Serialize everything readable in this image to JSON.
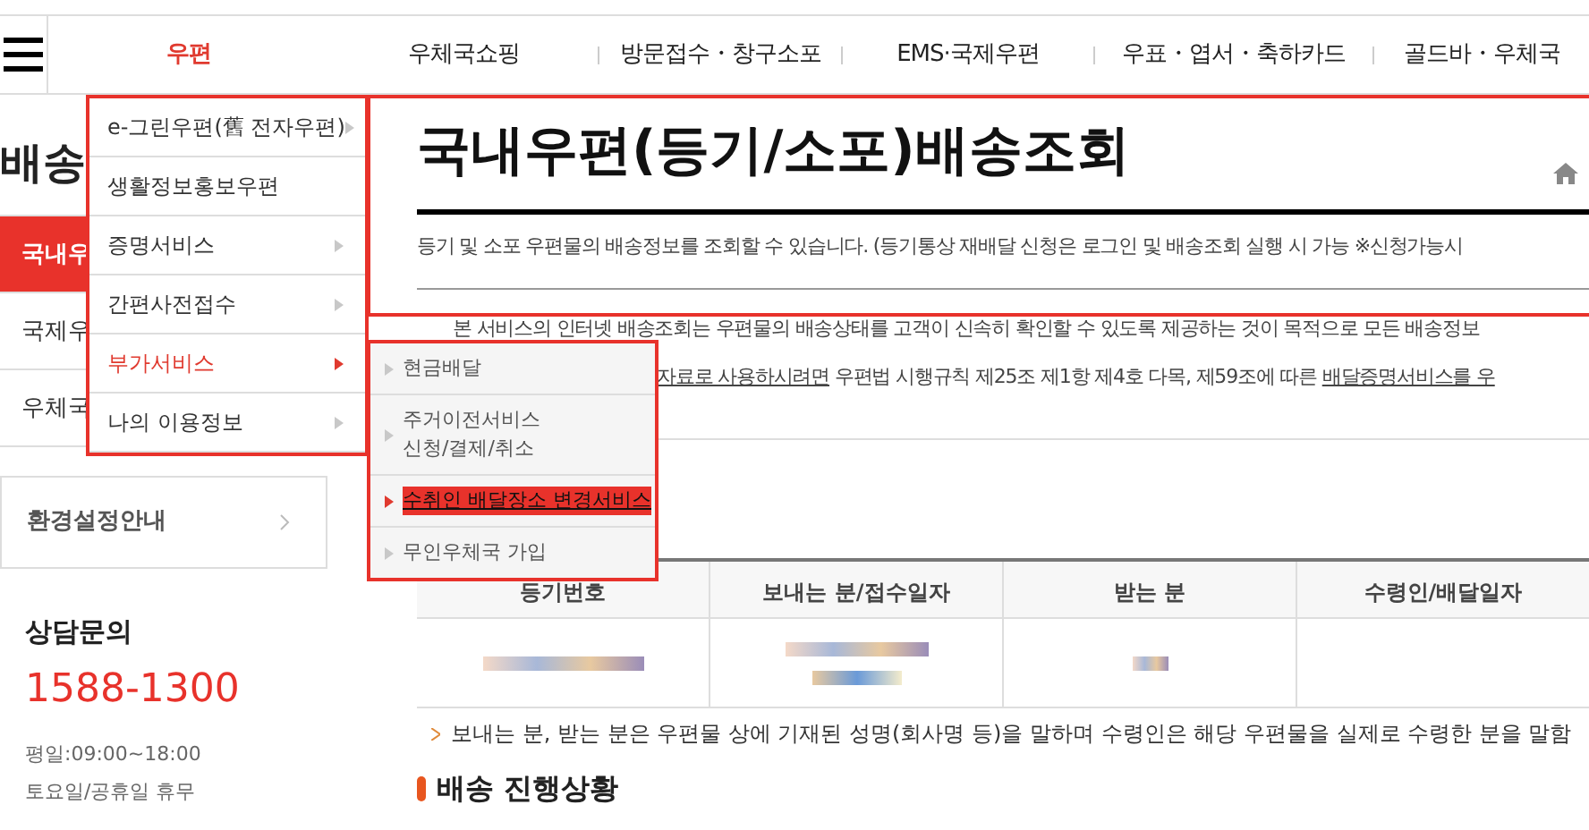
{
  "nav": {
    "items": [
      {
        "label": "우편",
        "selected": true
      },
      {
        "label": "우체국쇼핑",
        "selected": false
      },
      {
        "label": "방문접수・창구소포",
        "selected": false
      },
      {
        "label": "EMS·국제우편",
        "selected": false
      },
      {
        "label": "우표・엽서・축하카드",
        "selected": false
      },
      {
        "label": "골드바・우체국",
        "selected": false
      }
    ]
  },
  "sidebar": {
    "title": "배송",
    "items": [
      {
        "label": "국내우",
        "selected": true
      },
      {
        "label": "국제우",
        "selected": false
      },
      {
        "label": "우체국",
        "selected": false
      }
    ],
    "settings_link": "환경설정안내",
    "contact": {
      "title": "상담문의",
      "phone": "1588-1300",
      "hours": [
        "평일:09:00~18:00",
        "토요일/공휴일 휴무"
      ]
    }
  },
  "dropdown": {
    "items": [
      {
        "label": "e-그린우편(舊 전자우편)",
        "selected": false,
        "has_arrow": true
      },
      {
        "label": "생활정보홍보우편",
        "selected": false,
        "has_arrow": false
      },
      {
        "label": "증명서비스",
        "selected": false,
        "has_arrow": true
      },
      {
        "label": "간편사전접수",
        "selected": false,
        "has_arrow": true
      },
      {
        "label": "부가서비스",
        "selected": true,
        "has_arrow": true
      },
      {
        "label": "나의 이용정보",
        "selected": false,
        "has_arrow": true
      }
    ]
  },
  "submenu": {
    "items": [
      {
        "label": "현금배달",
        "selected": false
      },
      {
        "label": "주거이전서비스\n신청/결제/취소",
        "selected": false
      },
      {
        "label": "수취인 배달장소 변경서비스",
        "selected": true
      },
      {
        "label": "무인우체국 가입",
        "selected": false
      }
    ]
  },
  "page": {
    "title": "국내우편(등기/소포)배송조회",
    "description": "등기 및 소포 우편물의 배송정보를 조회할 수 있습니다. (등기통상 재배달 신청은 로그인 및 배송조회 실행 시 가능 ※신청가능시",
    "notice_line": "본 서비스의 인터넷 배송조회는 우편물의 배송상태를 고객이 신속히 확인할 수 있도록 제공하는 것이 목적으로 모든 배송정보",
    "notice_parts": [
      {
        "text": "자료로 사용하시려면",
        "link": true
      },
      {
        "text": " 우편법 시행규칙 제25조 제1항 제4호 다목, 제59조에 따른 ",
        "link": false
      },
      {
        "text": "배달증명서비스를 우",
        "link": true
      }
    ],
    "table": {
      "columns": [
        "등기번호",
        "보내는 분/접수일자",
        "받는 분",
        "수령인/배달일자"
      ]
    },
    "note": "보내는 분, 받는 분은 우편물 상에 기재된 성명(회사명 등)을 말하며 수령인은 해당 우편물을 실제로 수령한 분을 말함",
    "section_heading": "배송 진행상황"
  }
}
